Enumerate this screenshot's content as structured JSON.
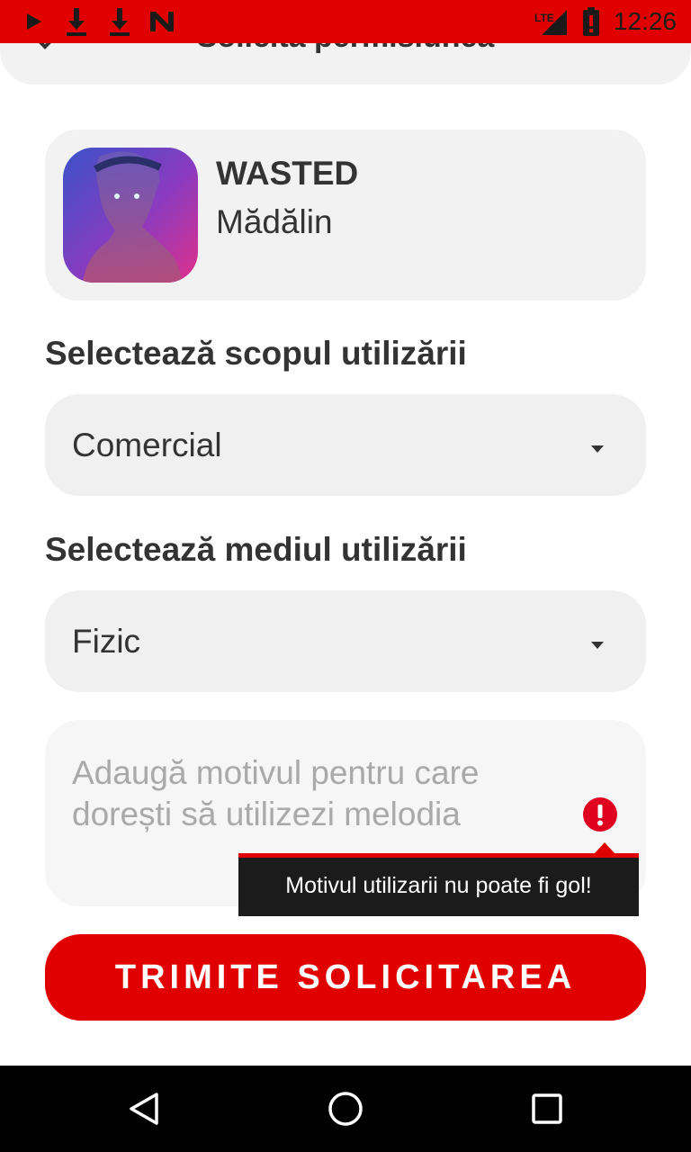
{
  "status_bar": {
    "time": "12:26",
    "network": "LTE",
    "icons": [
      "play-icon",
      "download-icon",
      "download-icon",
      "n-app-icon",
      "lte-signal-icon",
      "battery-alert-icon"
    ]
  },
  "header": {
    "title": "Solicită permisiunea"
  },
  "song": {
    "title": "WASTED",
    "artist": "Mădălin"
  },
  "usage_scope": {
    "label": "Selectează scopul utilizării",
    "selected": "Comercial"
  },
  "usage_medium": {
    "label": "Selectează mediul utilizării",
    "selected": "Fizic"
  },
  "reason": {
    "placeholder": "Adaugă motivul pentru care dorești să utilizezi melodia",
    "value": ""
  },
  "error": {
    "message": "Motivul utilizarii nu poate fi gol!"
  },
  "submit": {
    "label": "TRIMITE SOLICITAREA"
  },
  "colors": {
    "accent": "#e00000",
    "card": "#f2f2f2",
    "text": "#333333"
  }
}
